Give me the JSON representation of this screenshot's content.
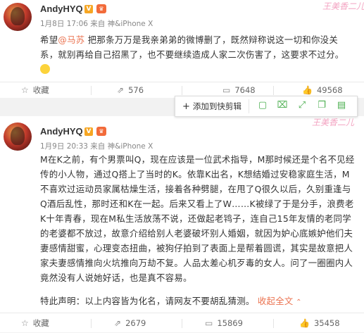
{
  "post1": {
    "username": "AndyHYQ",
    "meta": "1月8日 17:06 来自 神&iPhone X",
    "text_before": "希望",
    "mention": "@马苏",
    "text_after": " 把那条万万是我亲弟弟的微博删了，既然辩称说这一切和你没关系，就别再给自己招黑了，也不要继续造成人家二次伤害了，这要求不过分。",
    "watermark": "王美香二儿",
    "actions": {
      "collect": "收藏",
      "repost": "576",
      "comment": "7648",
      "like": "49568"
    }
  },
  "popup": {
    "add_label": "添加到快剪辑",
    "icons": [
      "save-icon",
      "clip-icon",
      "expand-icon",
      "copy-icon",
      "bookmark-icon"
    ]
  },
  "post2": {
    "username": "AndyHYQ",
    "meta": "1月9日 20:33 来自 神&iPhone X",
    "text": "M在K之前，有个男票叫Q，现在应该是一位武术指导，M那时候还是个名不见经传的小人物，通过Q搭上了当时的K。依靠K出名，K想结婚过安稳家庭生活，M不喜欢过运动员家属枯燥生活，接着各种劈腿，在甩了Q很久以后，久别重逢与Q酒后乱性，那时还和K在一起。后来又看上了W……K被绿了于是分手，浪费老K十年青春，现在M私生活放荡不说，还做起老鸨子，连自己15年友情的老同学的老婆都不放过，故意介绍给别人老婆破坏别人婚姻，就因为妒心底嫉妒他们夫妻感情甜蜜，心理变态扭曲，被狗仔拍到了表面上是帮着圆谎，其实是故意把人家夫妻感情推向火坑推向万劫不复。人品太差心机歹毒的女人。问了一圈圈内人竟然没有人说她好话，也是真不容易。",
    "disclaimer": "特此声明：以上内容皆为化名，请网友不要胡乱猜测。",
    "collapse": "收起全文",
    "watermark": "王美香二儿",
    "actions": {
      "collect": "收藏",
      "repost": "2679",
      "comment": "15869",
      "like": "35458"
    }
  },
  "colors": {
    "link": "#eb7350",
    "vip": "#f6a623",
    "watermark": "#f18db2"
  }
}
